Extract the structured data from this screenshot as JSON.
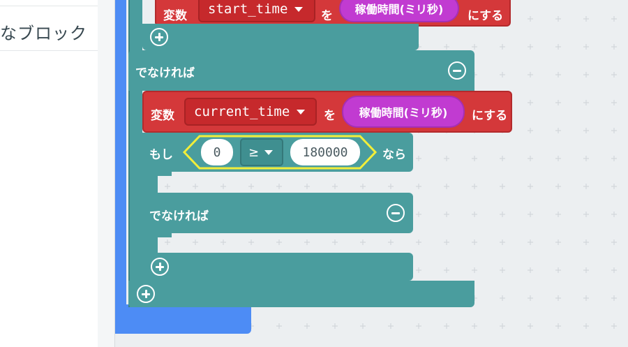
{
  "toolbox": {
    "category_fragment": "なブロック"
  },
  "blocks": {
    "set_start": {
      "keyword": "変数",
      "variable": "start_time",
      "assign_word": "を",
      "value_pill": "稼働時間(ミリ秒)",
      "suffix": "にする"
    },
    "else_outer": {
      "label": "でなければ"
    },
    "set_current": {
      "keyword": "変数",
      "variable": "current_time",
      "assign_word": "を",
      "value_pill": "稼働時間(ミリ秒)",
      "suffix": "にする"
    },
    "if_inner": {
      "if_word": "もし",
      "left_value": "0",
      "operator": "≥",
      "right_value": "180000",
      "then_word": "なら"
    },
    "else_inner": {
      "label": "でなければ"
    }
  },
  "icons": {
    "add": "plus-circle-icon",
    "remove": "minus-circle-icon",
    "dropdown": "caret-down-icon"
  },
  "colors": {
    "logic_teal": "#4a9d9e",
    "variable_red": "#d4383a",
    "pill_magenta": "#c13bd1",
    "loop_blue": "#4d8cf5",
    "highlight_yellow": "#f2ee3a"
  }
}
